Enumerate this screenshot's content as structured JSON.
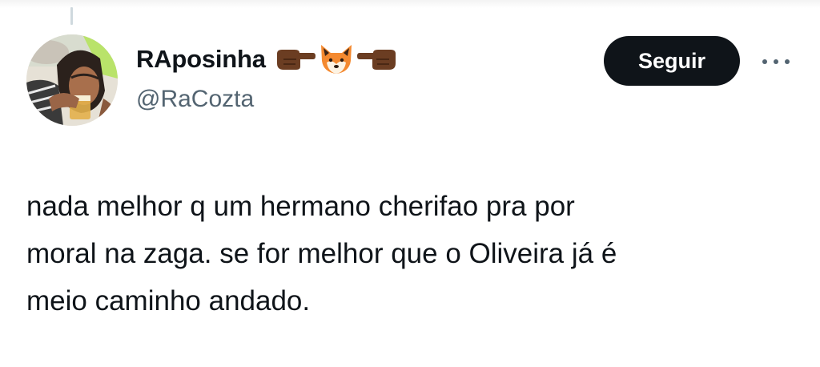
{
  "tweet": {
    "author": {
      "display_name": "RAposinha",
      "name_emojis": [
        "backhand-index-pointing-right-icon",
        "fox-face-icon",
        "backhand-index-pointing-left-icon"
      ],
      "handle": "@RaCozta"
    },
    "follow_label": "Seguir",
    "more_icon": "more-options-icon",
    "text": "nada melhor q um hermano cherifao  pra por\nmoral na zaga. se for melhor que o Oliveira já é\nmeio caminho andado."
  },
  "colors": {
    "text_primary": "#0f1419",
    "text_secondary": "#536471",
    "follow_bg": "#0f1419",
    "follow_text": "#ffffff"
  }
}
